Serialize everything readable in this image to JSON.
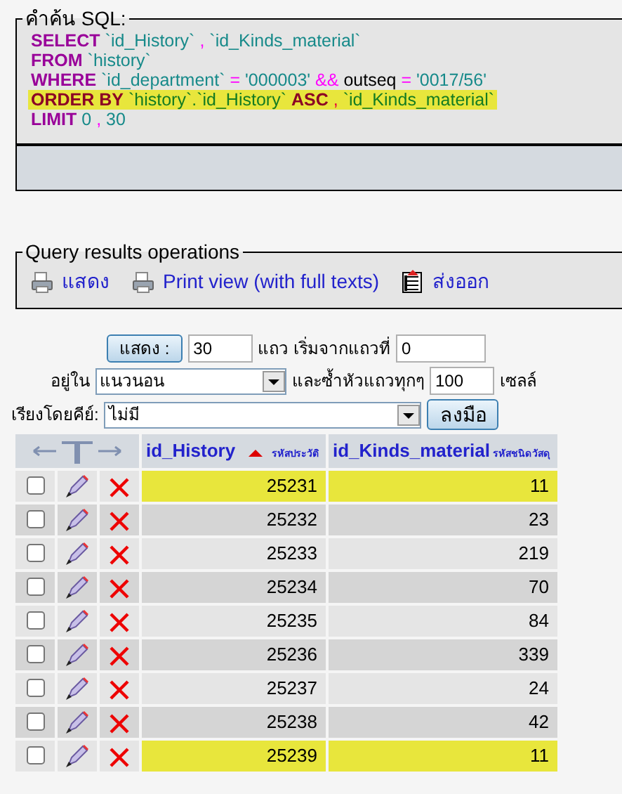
{
  "sql_box": {
    "legend": "คำค้น SQL:",
    "lines": [
      {
        "highlighted": false,
        "tokens": [
          {
            "kind": "keyword",
            "text": "SELECT"
          },
          {
            "kind": "identifier",
            "text": "`id_History`"
          },
          {
            "kind": "operator",
            "text": ","
          },
          {
            "kind": "identifier",
            "text": "`id_Kinds_material`"
          }
        ]
      },
      {
        "highlighted": false,
        "tokens": [
          {
            "kind": "keyword",
            "text": "FROM"
          },
          {
            "kind": "identifier",
            "text": "`history`"
          }
        ]
      },
      {
        "highlighted": false,
        "tokens": [
          {
            "kind": "keyword",
            "text": "WHERE"
          },
          {
            "kind": "identifier",
            "text": "`id_department`"
          },
          {
            "kind": "operator",
            "text": "="
          },
          {
            "kind": "string",
            "text": "'000003'"
          },
          {
            "kind": "operator",
            "text": "&&"
          },
          {
            "kind": "plain",
            "text": "outseq"
          },
          {
            "kind": "operator",
            "text": "="
          },
          {
            "kind": "string",
            "text": "'0017/56'"
          }
        ]
      },
      {
        "highlighted": true,
        "tokens": [
          {
            "kind": "keyword",
            "text": "ORDER BY"
          },
          {
            "kind": "identifier",
            "text": "`history`.`id_History`"
          },
          {
            "kind": "keyword",
            "text": "ASC"
          },
          {
            "kind": "operator",
            "text": ","
          },
          {
            "kind": "identifier",
            "text": "`id_Kinds_material`"
          }
        ]
      },
      {
        "highlighted": false,
        "tokens": [
          {
            "kind": "keyword",
            "text": "LIMIT"
          },
          {
            "kind": "number",
            "text": "0"
          },
          {
            "kind": "operator",
            "text": ","
          },
          {
            "kind": "number",
            "text": "30"
          }
        ]
      }
    ]
  },
  "operations": {
    "legend": "Query results operations",
    "links": [
      {
        "kind": "print",
        "text": "แสดง"
      },
      {
        "kind": "print",
        "text": "Print view (with full texts)"
      },
      {
        "kind": "export",
        "text": "ส่งออก"
      }
    ]
  },
  "display_form": {
    "show_button": "แสดง :",
    "rows_value": "30",
    "rows_label": "แถว เริ่มจากแถวที่",
    "start_value": "0",
    "mode_label": "อยู่ใน",
    "mode_value": "แนวนอน",
    "repeat_label": "และซ้ำหัวแถวทุกๆ",
    "repeat_value": "100",
    "repeat_unit": "เซลล์",
    "sort_label": "เรียงโดยคีย์:",
    "sort_value": "ไม่มี",
    "go_button": "ลงมือ"
  },
  "table": {
    "columns": [
      {
        "name": "id_History",
        "sorted": true,
        "comment": "รหัสประวัติ"
      },
      {
        "name": "id_Kinds_material",
        "sorted": false,
        "comment": "รหัสชนิดวัสดุ"
      }
    ],
    "rows": [
      {
        "checked": false,
        "highlighted": true,
        "cells": [
          "25231",
          "11"
        ]
      },
      {
        "checked": false,
        "highlighted": false,
        "cells": [
          "25232",
          "23"
        ]
      },
      {
        "checked": false,
        "highlighted": false,
        "cells": [
          "25233",
          "219"
        ]
      },
      {
        "checked": false,
        "highlighted": false,
        "cells": [
          "25234",
          "70"
        ]
      },
      {
        "checked": false,
        "highlighted": false,
        "cells": [
          "25235",
          "84"
        ]
      },
      {
        "checked": false,
        "highlighted": false,
        "cells": [
          "25236",
          "339"
        ]
      },
      {
        "checked": false,
        "highlighted": false,
        "cells": [
          "25237",
          "24"
        ]
      },
      {
        "checked": false,
        "highlighted": false,
        "cells": [
          "25238",
          "42"
        ]
      },
      {
        "checked": false,
        "highlighted": true,
        "cells": [
          "25239",
          "11"
        ]
      }
    ]
  }
}
